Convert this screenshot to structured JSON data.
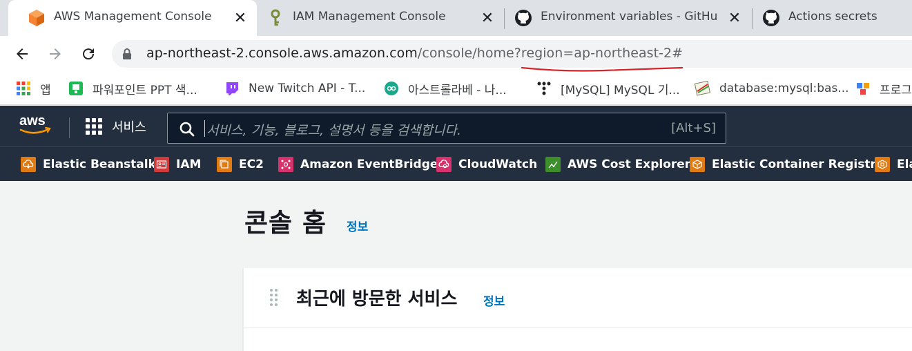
{
  "browser": {
    "tabs": [
      {
        "title": "AWS Management Console",
        "active": true
      },
      {
        "title": "IAM Management Console",
        "active": false
      },
      {
        "title": "Environment variables - GitHub",
        "active": false
      },
      {
        "title": "Actions secrets",
        "active": false
      }
    ],
    "url": {
      "host": "ap-northeast-2.console.aws.amazon.com",
      "path": "/console/home?region=ap-northeast-2#"
    },
    "bookmarks": [
      {
        "label": "앱",
        "icon": "apps-grid-icon"
      },
      {
        "label": "파워포인트 PPT 색...",
        "icon": "ppt-bookmark-icon"
      },
      {
        "label": "New Twitch API - T...",
        "icon": "twitch-icon"
      },
      {
        "label": "아스트롤라베 - 나...",
        "icon": "astrolabe-icon"
      },
      {
        "label": "[MySQL] MySQL 기...",
        "icon": "tistory-icon"
      },
      {
        "label": "database:mysql:bas...",
        "icon": "wiki-icon"
      },
      {
        "label": "프로그",
        "icon": "puzzle-icon"
      }
    ]
  },
  "aws_header": {
    "logo_text": "aws",
    "services_label": "서비스",
    "search_placeholder": "서비스, 기능, 블로그, 설명서 등을 검색합니다.",
    "search_shortcut": "[Alt+S]"
  },
  "favorites": [
    {
      "label": "Elastic Beanstalk",
      "color": "#e07b14"
    },
    {
      "label": "IAM",
      "color": "#d13a3a"
    },
    {
      "label": "EC2",
      "color": "#e07b14"
    },
    {
      "label": "Amazon EventBridge",
      "color": "#d6336c"
    },
    {
      "label": "CloudWatch",
      "color": "#d6336c"
    },
    {
      "label": "AWS Cost Explorer",
      "color": "#3c8f2b"
    },
    {
      "label": "Elastic Container Registry",
      "color": "#e07b14"
    },
    {
      "label": "Ela",
      "color": "#e07b14"
    }
  ],
  "main": {
    "page_title": "콘솔 홈",
    "page_info": "정보",
    "recent_title": "최근에 방문한 서비스",
    "recent_info": "정보"
  },
  "colors": {
    "aws_nav": "#232f3e",
    "link": "#0073bb",
    "annotation": "#d8232a"
  }
}
